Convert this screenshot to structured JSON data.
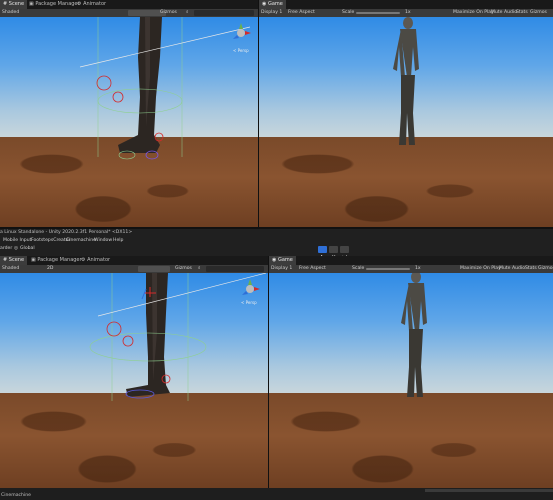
{
  "top": {
    "scene_tabs": [
      "Scene",
      "Package Manager",
      "Animator"
    ],
    "game_tab": "Game",
    "shading": "Shaded",
    "gizmos": "Gizmos",
    "display": "Display 1",
    "aspect": "Free Aspect",
    "scale_label": "Scale",
    "scale_value": "1x",
    "game_options": [
      "Maximize On Play",
      "Mute Audio",
      "Stats",
      "Gizmos"
    ],
    "persp": "< Persp"
  },
  "window": {
    "title": "a Linux Standalone - Unity 2020.2.3f1 Personal* <DX11>",
    "menus": [
      "Mobile Input",
      "FootstepsCreator",
      "Cinemachine",
      "Window",
      "Help"
    ],
    "left_fragment": "arder",
    "global": "Global"
  },
  "bottom": {
    "scene_tabs": [
      "Scene",
      "Package Manager",
      "Animator"
    ],
    "game_tab": "Game",
    "shading": "Shaded",
    "mode_2d": "2D",
    "gizmos": "Gizmos",
    "display": "Display 1",
    "aspect": "Free Aspect",
    "scale_label": "Scale",
    "scale_value": "1x",
    "game_options": [
      "Maximize On Play",
      "Mute Audio",
      "Stats",
      "Gizmos"
    ],
    "persp": "< Persp"
  },
  "status": {
    "text": "Cinemachine"
  },
  "colors": {
    "accent": "#2f6fd6",
    "sky": "#4a9ae6",
    "ground": "#7f4c2c"
  }
}
